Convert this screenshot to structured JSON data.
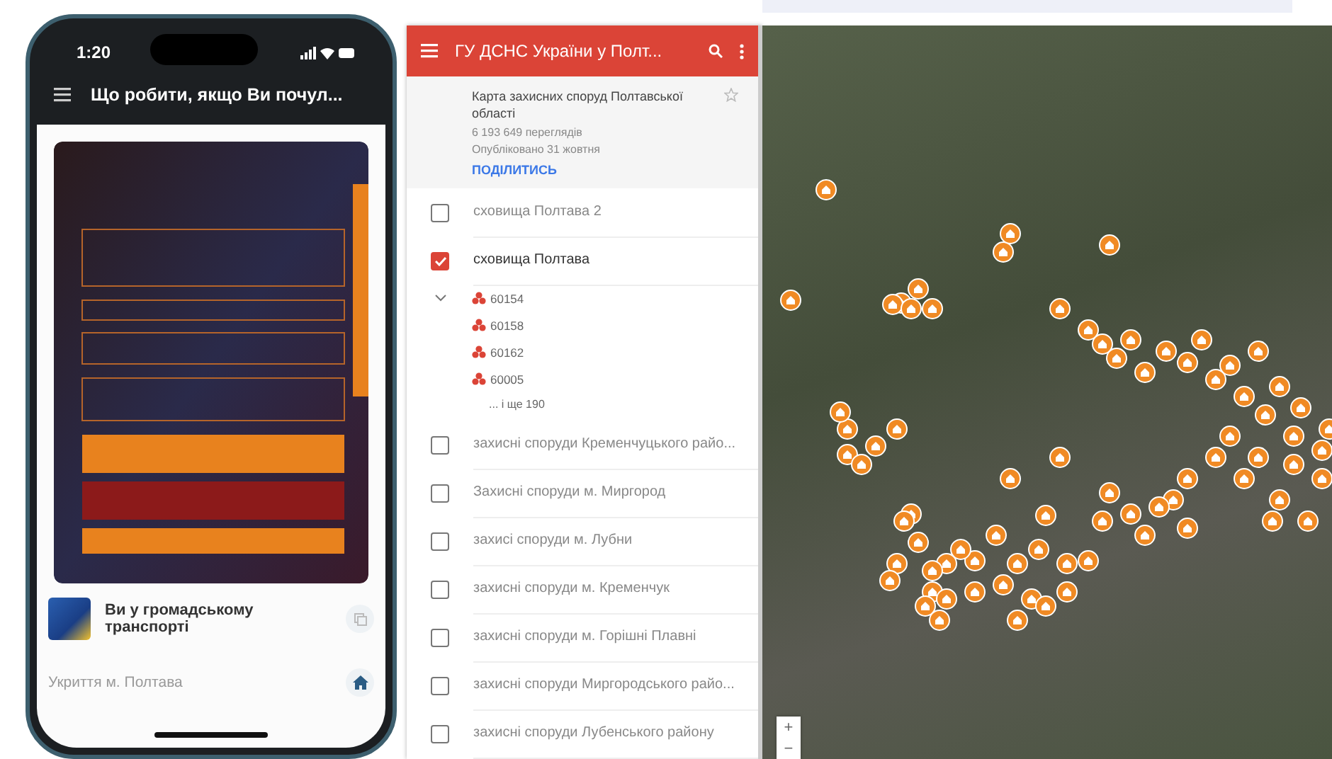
{
  "phone": {
    "status": {
      "time": "1:20"
    },
    "header": {
      "title": "Що робити, якщо Ви почул..."
    },
    "items": [
      {
        "title": "Ви у громадському транспорті"
      }
    ],
    "section": {
      "title": "Укриття м. Полтава"
    }
  },
  "panel": {
    "title": "ГУ ДСНС України у Полт...",
    "map_title": "Карта захисних споруд Полтавської області",
    "views": "6 193 649 переглядів",
    "published": "Опубліковано 31 жовтня",
    "share": "ПОДІЛИТИСЬ",
    "layers": [
      {
        "name": "сховища Полтава 2",
        "checked": false
      },
      {
        "name": "сховища Полтава",
        "checked": true,
        "expanded": true,
        "children": [
          {
            "name": "60154"
          },
          {
            "name": "60158"
          },
          {
            "name": "60162"
          },
          {
            "name": "60005"
          }
        ],
        "more": "... і ще 190"
      },
      {
        "name": "захисні споруди Кременчуцького райо...",
        "checked": false
      },
      {
        "name": "Захисні споруди м. Миргород",
        "checked": false
      },
      {
        "name": "захисі споруди м. Лубни",
        "checked": false
      },
      {
        "name": "захисні споруди м. Кременчук",
        "checked": false
      },
      {
        "name": "захисні споруди м. Горішні Плавні",
        "checked": false
      },
      {
        "name": "захисні споруди Миргородського райо...",
        "checked": false
      },
      {
        "name": "захисні споруди Лубенського району",
        "checked": false
      }
    ]
  },
  "map": {
    "zoom_in": "+",
    "zoom_out": "−"
  }
}
